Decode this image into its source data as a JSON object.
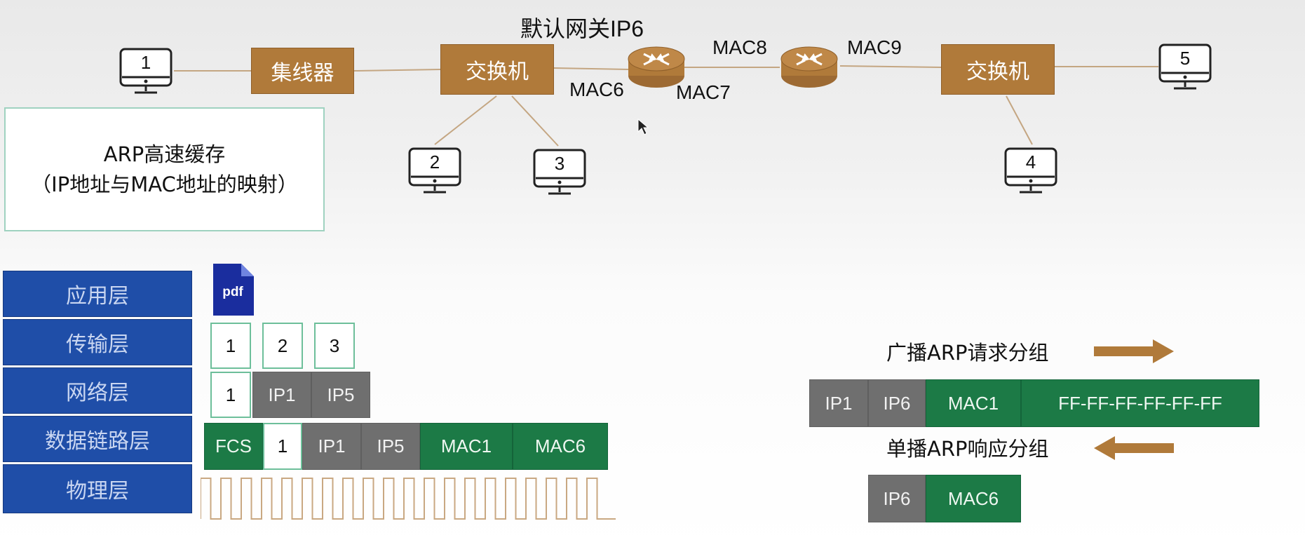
{
  "topology": {
    "gateway_label": "默认网关IP6",
    "hub_label": "集线器",
    "switch_left_label": "交换机",
    "switch_right_label": "交换机",
    "mac_labels": {
      "mac6": "MAC6",
      "mac7": "MAC7",
      "mac8": "MAC8",
      "mac9": "MAC9"
    },
    "pcs": [
      "1",
      "2",
      "3",
      "4",
      "5"
    ]
  },
  "arp_cache": {
    "line1": "ARP高速缓存",
    "line2": "（IP地址与MAC地址的映射）"
  },
  "layers": [
    "应用层",
    "传输层",
    "网络层",
    "数据链路层",
    "物理层"
  ],
  "application": {
    "file_icon_text": "pdf"
  },
  "transport_segments": [
    "1",
    "2",
    "3"
  ],
  "network_packet": [
    "1",
    "IP1",
    "IP5"
  ],
  "frame": [
    "FCS",
    "1",
    "IP1",
    "IP5",
    "MAC1",
    "MAC6"
  ],
  "arp_request": {
    "caption": "广播ARP请求分组",
    "fields": [
      "IP1",
      "IP6",
      "MAC1",
      "FF-FF-FF-FF-FF-FF"
    ]
  },
  "arp_reply": {
    "caption": "单播ARP响应分组",
    "fields": [
      "IP6",
      "MAC6"
    ]
  },
  "colors": {
    "device": "#b07a3a",
    "layer": "#1f4ea8",
    "gray": "#6f6f6f",
    "green": "#1c7a46",
    "arrow": "#b07a3a",
    "signal": "#c9a882"
  }
}
